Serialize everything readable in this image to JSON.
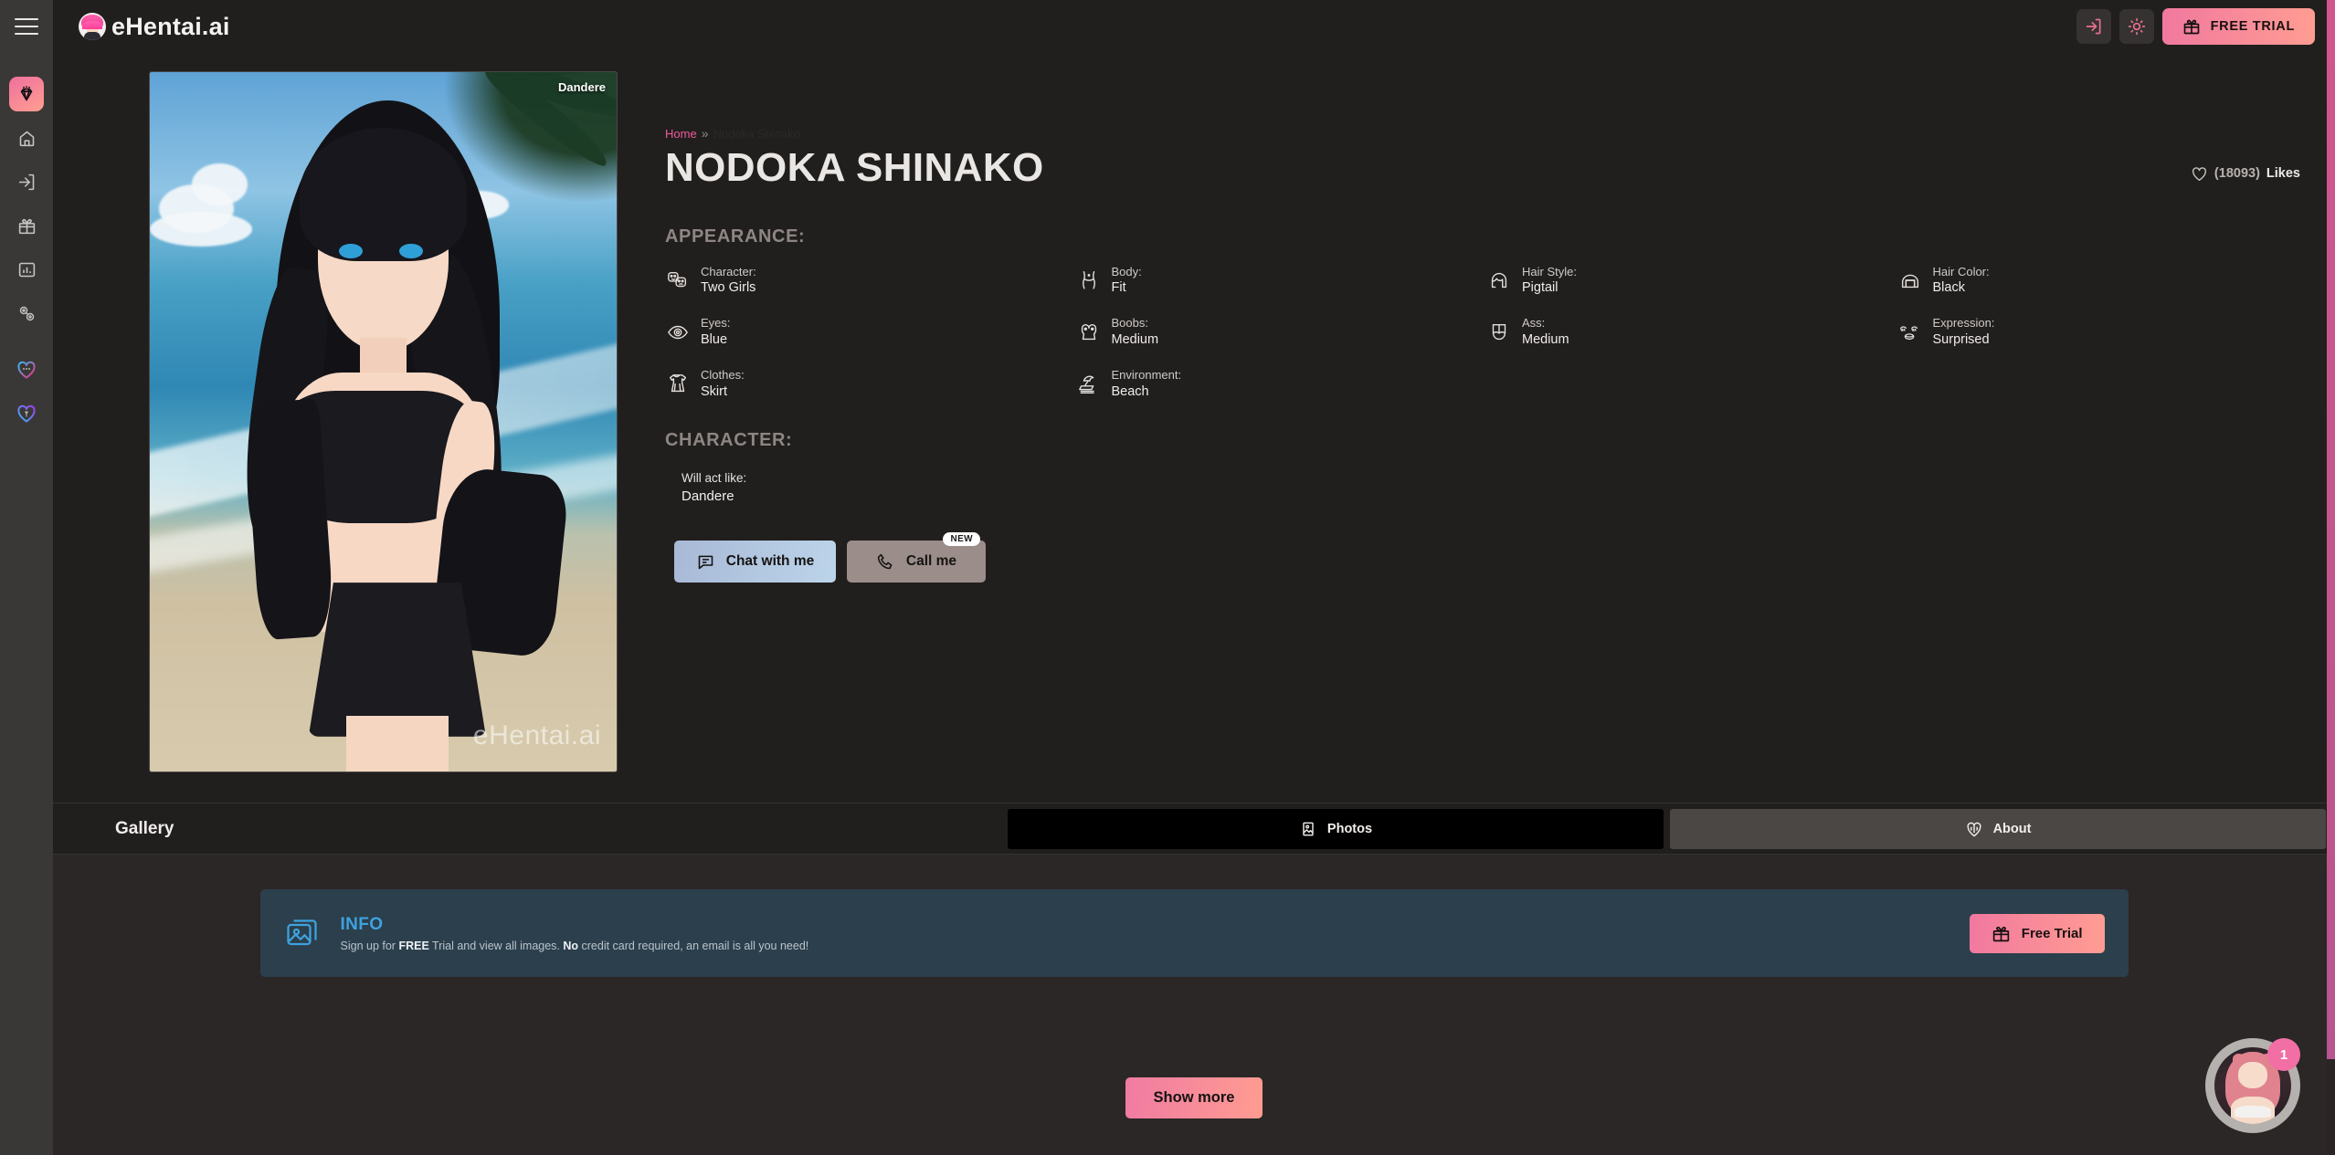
{
  "header": {
    "menu_icon": "hamburger-menu-icon",
    "brand": "eHentai.ai",
    "login_icon": "login-icon",
    "theme_icon": "sun-brightness-icon",
    "free_trial_label": "FREE TRIAL",
    "gift_icon": "gift-icon"
  },
  "sidebar": {
    "items": [
      {
        "name": "premium",
        "icon": "diamond-icon",
        "active": true
      },
      {
        "name": "home",
        "icon": "home-icon",
        "active": false
      },
      {
        "name": "login",
        "icon": "login-icon",
        "active": false
      },
      {
        "name": "gift",
        "icon": "gift-icon",
        "active": false
      },
      {
        "name": "stats",
        "icon": "chart-box-icon",
        "active": false
      },
      {
        "name": "affiliate",
        "icon": "affiliate-network-icon",
        "active": false
      },
      {
        "name": "chat",
        "icon": "chat-heart-icon",
        "active": false
      },
      {
        "name": "favorites",
        "icon": "heart-person-icon",
        "active": false
      }
    ]
  },
  "breadcrumb": {
    "home": "Home",
    "separator": "»",
    "current": "Nodoka Shinako"
  },
  "character": {
    "title": "NODOKA SHINAKO",
    "tag": "Dandere",
    "watermark": "eHentai.ai",
    "likes_count": "(18093)",
    "likes_label": "Likes",
    "heart_icon": "heart-outline-icon"
  },
  "appearance": {
    "heading": "APPEARANCE:",
    "attributes": [
      {
        "key": "Character:",
        "value": "Two Girls",
        "icon": "theater-masks-icon"
      },
      {
        "key": "Body:",
        "value": "Fit",
        "icon": "body-figure-icon"
      },
      {
        "key": "Hair Style:",
        "value": "Pigtail",
        "icon": "hair-style-icon"
      },
      {
        "key": "Hair Color:",
        "value": "Black",
        "icon": "hair-color-icon"
      },
      {
        "key": "Eyes:",
        "value": "Blue",
        "icon": "eye-icon"
      },
      {
        "key": "Boobs:",
        "value": "Medium",
        "icon": "breasts-icon"
      },
      {
        "key": "Ass:",
        "value": "Medium",
        "icon": "buttocks-icon"
      },
      {
        "key": "Expression:",
        "value": "Surprised",
        "icon": "face-expression-icon"
      },
      {
        "key": "Clothes:",
        "value": "Skirt",
        "icon": "clothes-dress-icon"
      },
      {
        "key": "Environment:",
        "value": "Beach",
        "icon": "beach-umbrella-icon"
      }
    ]
  },
  "character_section": {
    "heading": "CHARACTER:",
    "will_act_like_label": "Will act like:",
    "will_act_like_value": "Dandere"
  },
  "cta": {
    "chat_label": "Chat with me",
    "chat_icon": "chat-bubble-icon",
    "call_label": "Call me",
    "call_icon": "phone-icon",
    "new_badge": "NEW"
  },
  "gallery": {
    "title": "Gallery",
    "tabs": [
      {
        "label": "Photos",
        "icon": "photo-image-icon",
        "active": true
      },
      {
        "label": "About",
        "icon": "heart-brain-icon",
        "active": false
      }
    ]
  },
  "info_banner": {
    "icon": "images-stack-icon",
    "title": "INFO",
    "text_before": "Sign up for ",
    "free_strong": "FREE",
    "text_middle": " Trial and view all images. ",
    "no_strong": "No",
    "text_after": " credit card required, an email is all you need!",
    "button_label": "Free Trial",
    "button_icon": "gift-icon"
  },
  "footer": {
    "show_more_label": "Show more"
  },
  "chat_widget": {
    "badge": "1",
    "avatar_icon": "chat-assistant-avatar"
  },
  "colors": {
    "accent_pink": "#f1789f",
    "accent_peach": "#ff9d92",
    "link_pink": "#ee5a9a",
    "info_blue": "#3ea2e0",
    "banner_bg": "#2c3f4c",
    "page_bg": "#211f1e",
    "sidebar_bg": "#3a3837",
    "content_bg": "#2a2726"
  }
}
